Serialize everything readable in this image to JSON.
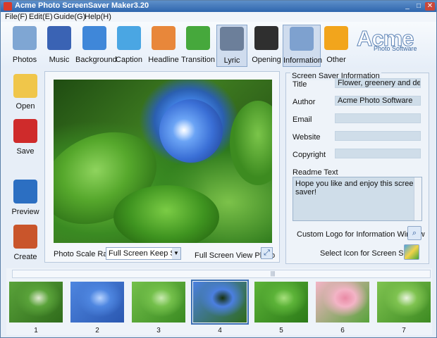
{
  "window": {
    "title": "Acme Photo ScreenSaver Maker3.20",
    "controls": {
      "minimize": "_",
      "maximize": "□",
      "close": "✕"
    }
  },
  "menu": [
    {
      "label": "File(F)"
    },
    {
      "label": "Edit(E)"
    },
    {
      "label": "Guide(G)"
    },
    {
      "label": "Help(H)"
    }
  ],
  "toolbar": [
    {
      "label": "Photos",
      "icon": "photos-icon",
      "color": "#7fa6d3"
    },
    {
      "label": "Music",
      "icon": "music-icon",
      "color": "#3a63b4"
    },
    {
      "label": "Background",
      "icon": "background-icon",
      "color": "#3f87d9"
    },
    {
      "label": "Caption",
      "icon": "caption-icon",
      "color": "#4aa6e3"
    },
    {
      "label": "Headline",
      "icon": "headline-icon",
      "color": "#e8873a"
    },
    {
      "label": "Transition",
      "icon": "transition-icon",
      "color": "#46a83c"
    },
    {
      "label": "Lyric",
      "icon": "lyric-icon",
      "color": "#6c7f9a"
    },
    {
      "label": "Opening",
      "icon": "opening-icon",
      "color": "#2f2f2f"
    },
    {
      "label": "Information",
      "icon": "information-icon",
      "color": "#7ea1cf"
    },
    {
      "label": "Other",
      "icon": "other-icon",
      "color": "#f2a51c"
    }
  ],
  "logo": {
    "big": "Acme",
    "small": "Photo Software"
  },
  "sidebar": [
    {
      "label": "Open",
      "icon": "open-folder-icon",
      "color": "#f0c64a"
    },
    {
      "label": "Save",
      "icon": "save-icon",
      "color": "#cf2b2b"
    },
    {
      "label": "Preview",
      "icon": "preview-icon",
      "color": "#2c6fc2"
    },
    {
      "label": "Create",
      "icon": "create-tools-icon",
      "color": "#c9552b"
    }
  ],
  "preview": {
    "scale_label": "Photo Scale Ratio",
    "scale_value": "Full Screen Keep Scale",
    "fullscreen_label": "Full Screen View Photo"
  },
  "info": {
    "group_title": "Screen Saver Information",
    "fields": [
      {
        "label": "Title",
        "value": "Flower, greenery and dew"
      },
      {
        "label": "Author",
        "value": "Acme Photo Software"
      },
      {
        "label": "Email",
        "value": ""
      },
      {
        "label": "Website",
        "value": ""
      },
      {
        "label": "Copyright",
        "value": ""
      }
    ],
    "readme_label": "Readme Text",
    "readme_value": "Hope you like and enjoy this screen saver!",
    "custom_logo_label": "Custom Logo for Information Window",
    "select_icon_label": "Select Icon for Screen Saver"
  },
  "thumbnails": [
    {
      "number": "1",
      "selected": false,
      "palette": [
        "#5aa33a",
        "#2f6b1b",
        "#dfe9d0"
      ]
    },
    {
      "number": "2",
      "selected": false,
      "palette": [
        "#4e86e0",
        "#2a57b0",
        "#b8d4ff"
      ]
    },
    {
      "number": "3",
      "selected": false,
      "palette": [
        "#74c04b",
        "#3a8a22",
        "#c9eab1"
      ]
    },
    {
      "number": "4",
      "selected": true,
      "palette": [
        "#4b7fe0",
        "#2f6b1b",
        "#152f0b"
      ]
    },
    {
      "number": "5",
      "selected": false,
      "palette": [
        "#5cb338",
        "#2c7a18",
        "#a7e07d"
      ]
    },
    {
      "number": "6",
      "selected": false,
      "palette": [
        "#f3b4c6",
        "#57a33a",
        "#e98aa5"
      ]
    },
    {
      "number": "7",
      "selected": false,
      "palette": [
        "#7fc350",
        "#3d8a22",
        "#e9f4df"
      ]
    }
  ]
}
